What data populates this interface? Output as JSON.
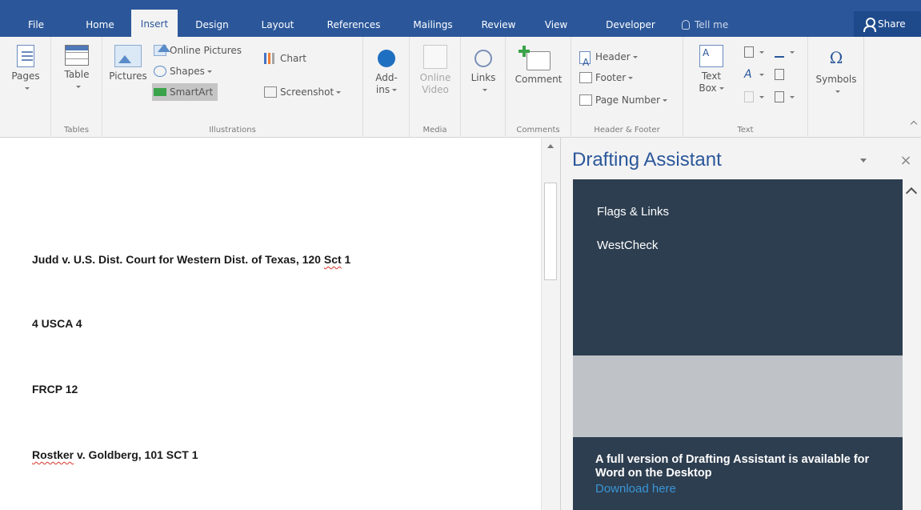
{
  "tabs": [
    "File",
    "Home",
    "Insert",
    "Design",
    "Layout",
    "References",
    "Mailings",
    "Review",
    "View",
    "Developer"
  ],
  "active_tab": "Insert",
  "tell_me": "Tell me",
  "share": "Share",
  "ribbon": {
    "pages": {
      "label": "Pages"
    },
    "tables": {
      "table_label": "Table",
      "group": "Tables"
    },
    "illustrations": {
      "pictures": "Pictures",
      "online_pictures": "Online Pictures",
      "shapes": "Shapes",
      "smartart": "SmartArt",
      "chart": "Chart",
      "screenshot": "Screenshot",
      "group": "Illustrations"
    },
    "addins": {
      "line1": "Add-",
      "line2": "ins"
    },
    "media": {
      "line1": "Online",
      "line2": "Video",
      "group": "Media"
    },
    "links": {
      "label": "Links"
    },
    "comments": {
      "label": "Comment",
      "group": "Comments"
    },
    "header_footer": {
      "header": "Header",
      "footer": "Footer",
      "page_number": "Page Number",
      "group": "Header & Footer"
    },
    "text": {
      "line1": "Text",
      "line2": "Box",
      "group": "Text"
    },
    "symbols": {
      "label": "Symbols"
    }
  },
  "document": {
    "lines": [
      {
        "before": "Judd v. U.S. Dist. Court for Western Dist. of Texas, 120 ",
        "flagged": "Sct",
        "after": " 1"
      },
      {
        "before": "4 USCA 4",
        "flagged": "",
        "after": ""
      },
      {
        "before": "FRCP 12",
        "flagged": "",
        "after": ""
      },
      {
        "before": "",
        "flagged": "Rostker",
        "after": " v. Goldberg, 101 SCT 1"
      }
    ]
  },
  "pane": {
    "title": "Drafting Assistant",
    "menu": [
      "Flags & Links",
      "WestCheck"
    ],
    "banner": "A full version of Drafting Assistant is available for Word on the Desktop",
    "link": "Download here"
  },
  "colors": {
    "word_blue": "#2b579a",
    "pane_dark": "#2d3e50",
    "link_blue": "#3a96d6",
    "spell_red": "#d9342b"
  }
}
